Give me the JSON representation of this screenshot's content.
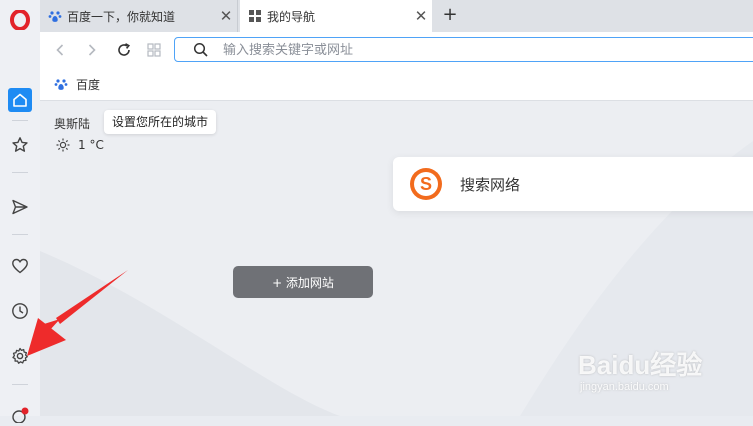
{
  "browser": {
    "brand_color": "#e2232a",
    "accent": "#4fa3f7"
  },
  "tabs": [
    {
      "title": "百度一下，你就知道",
      "icon": "baidu-paw-icon",
      "active": false
    },
    {
      "title": "我的导航",
      "icon": "grid-icon",
      "active": true
    }
  ],
  "toolbar": {
    "url_placeholder": "输入搜索关键字或网址"
  },
  "bookmarks": [
    {
      "label": "百度",
      "icon": "baidu-paw-icon"
    }
  ],
  "sidebar": {
    "items": [
      {
        "name": "home-icon",
        "active": true
      },
      {
        "name": "star-icon"
      },
      {
        "name": "send-icon"
      },
      {
        "name": "heart-icon"
      },
      {
        "name": "clock-icon"
      },
      {
        "name": "gear-icon"
      }
    ]
  },
  "start_page": {
    "city": "奥斯陆",
    "city_tooltip": "设置您所在的城市",
    "temperature": "1 °C",
    "search_card_label": "搜索网络",
    "add_site_label": "+ 添加网站"
  },
  "watermark": {
    "main": "Baidu经验",
    "sub": "jingyan.baidu.com"
  }
}
